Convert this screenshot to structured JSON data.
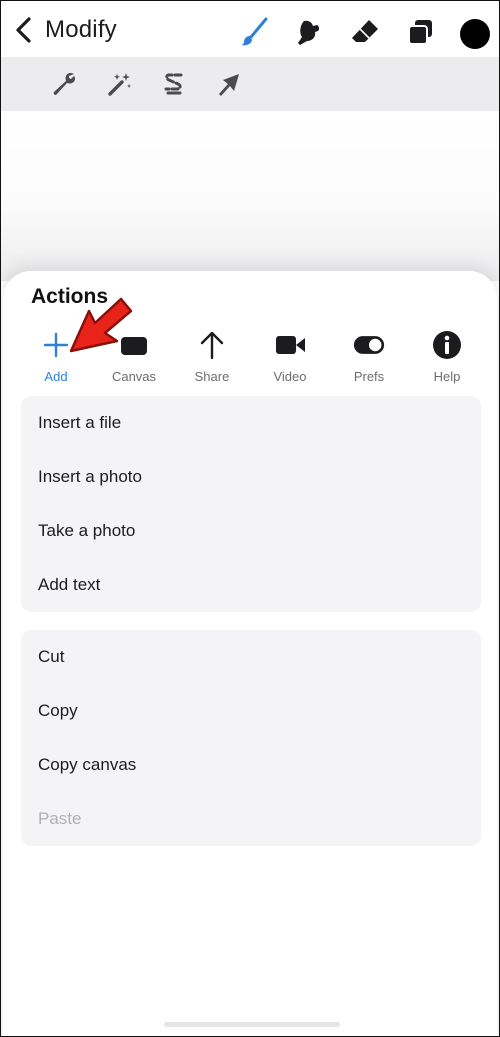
{
  "header": {
    "back_label": "Modify",
    "tools": [
      "brush-icon",
      "smudge-icon",
      "eraser-icon",
      "layers-icon",
      "color-swatch"
    ],
    "active_tool": "brush-icon",
    "accent_color": "#2f80d8",
    "current_color": "#000000"
  },
  "subtoolbar": {
    "tools": [
      "wrench-icon",
      "magic-wand-icon",
      "selection-icon",
      "move-arrow-icon"
    ]
  },
  "actions": {
    "title": "Actions",
    "tabs": [
      {
        "label": "Add",
        "icon": "plus-icon",
        "active": true
      },
      {
        "label": "Canvas",
        "icon": "canvas-icon",
        "active": false
      },
      {
        "label": "Share",
        "icon": "share-arrow-icon",
        "active": false
      },
      {
        "label": "Video",
        "icon": "video-camera-icon",
        "active": false
      },
      {
        "label": "Prefs",
        "icon": "toggle-icon",
        "active": false
      },
      {
        "label": "Help",
        "icon": "info-icon",
        "active": false
      }
    ],
    "groups": [
      {
        "items": [
          {
            "label": "Insert a file",
            "enabled": true
          },
          {
            "label": "Insert a photo",
            "enabled": true
          },
          {
            "label": "Take a photo",
            "enabled": true
          },
          {
            "label": "Add text",
            "enabled": true
          }
        ]
      },
      {
        "items": [
          {
            "label": "Cut",
            "enabled": true
          },
          {
            "label": "Copy",
            "enabled": true
          },
          {
            "label": "Copy canvas",
            "enabled": true
          },
          {
            "label": "Paste",
            "enabled": false
          }
        ]
      }
    ]
  },
  "annotation": {
    "icon": "red-pointer-arrow-icon",
    "color": "#e8231a"
  }
}
